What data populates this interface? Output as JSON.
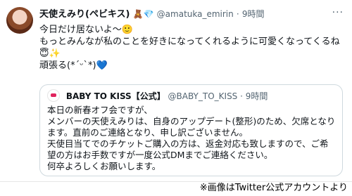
{
  "tweet": {
    "display_name": "天使えみり(ペビキス)",
    "name_emojis": "🧸💎",
    "handle": "@amatuka_emirin",
    "dot": "·",
    "time": "9時間",
    "more": "···",
    "lines": [
      "今日だけ居ないよ〜🙂",
      "もっとみんなが私のことを好きになってくれるように可愛くなってくるね",
      "😇✨",
      "頑張る(*ˊᵕˋ*)💙"
    ]
  },
  "quote": {
    "display_name": "BABY TO KISS【公式】",
    "handle": "@BABY_TO_KISS",
    "dot": "·",
    "time": "9時間",
    "lines": [
      "本日の新春オフ会ですが、",
      "メンバーの天使えみりは、自身のアップデート(整形)のため、欠席となり",
      "ます。直前のご連絡となり、申し訳ございません。",
      "天使目当てでのチケットご購入の方は、返金対応も致しますので、ご希",
      "望の方はお手数ですが一度公式DMまでご連絡ください。",
      "何卒よろしくお願いします。"
    ]
  },
  "credit": "※画像はTwitter公式アカウントより"
}
